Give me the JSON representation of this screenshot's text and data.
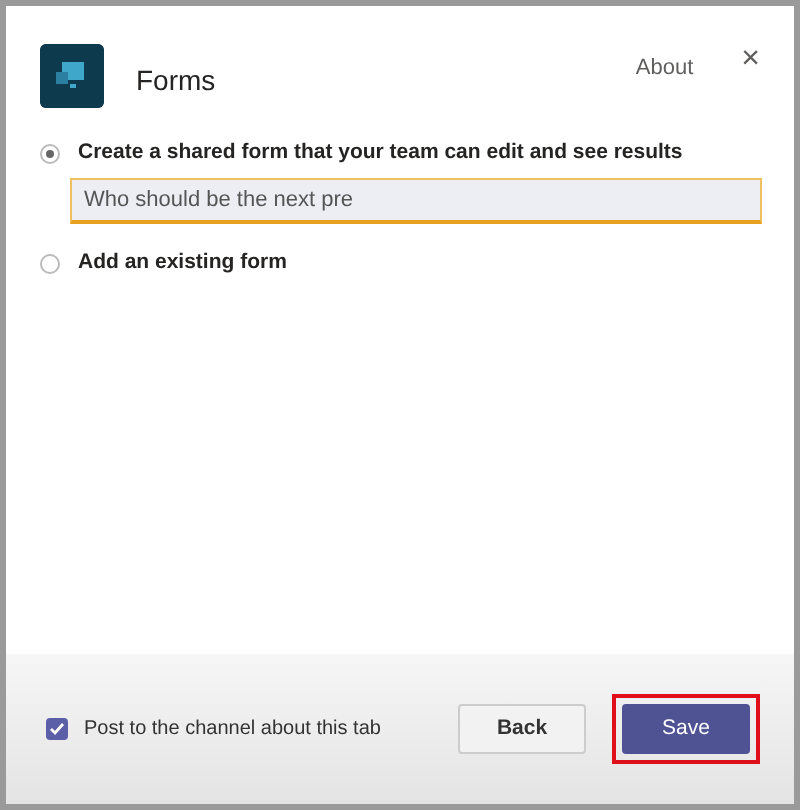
{
  "header": {
    "title": "Forms",
    "about": "About",
    "close": "×"
  },
  "options": [
    {
      "label": "Create a shared form that your team can edit and see results",
      "selected": true,
      "field": {
        "value": "Who should be the next pre",
        "focused": true
      }
    },
    {
      "label": "Add an existing form",
      "selected": false
    }
  ],
  "footer": {
    "post": {
      "label": "Post to the channel about this tab",
      "checked": true
    },
    "buttons": [
      {
        "label": "Back",
        "kind": "secondary",
        "highlighted": false
      },
      {
        "label": "Save",
        "kind": "primary",
        "highlighted": true
      }
    ]
  }
}
